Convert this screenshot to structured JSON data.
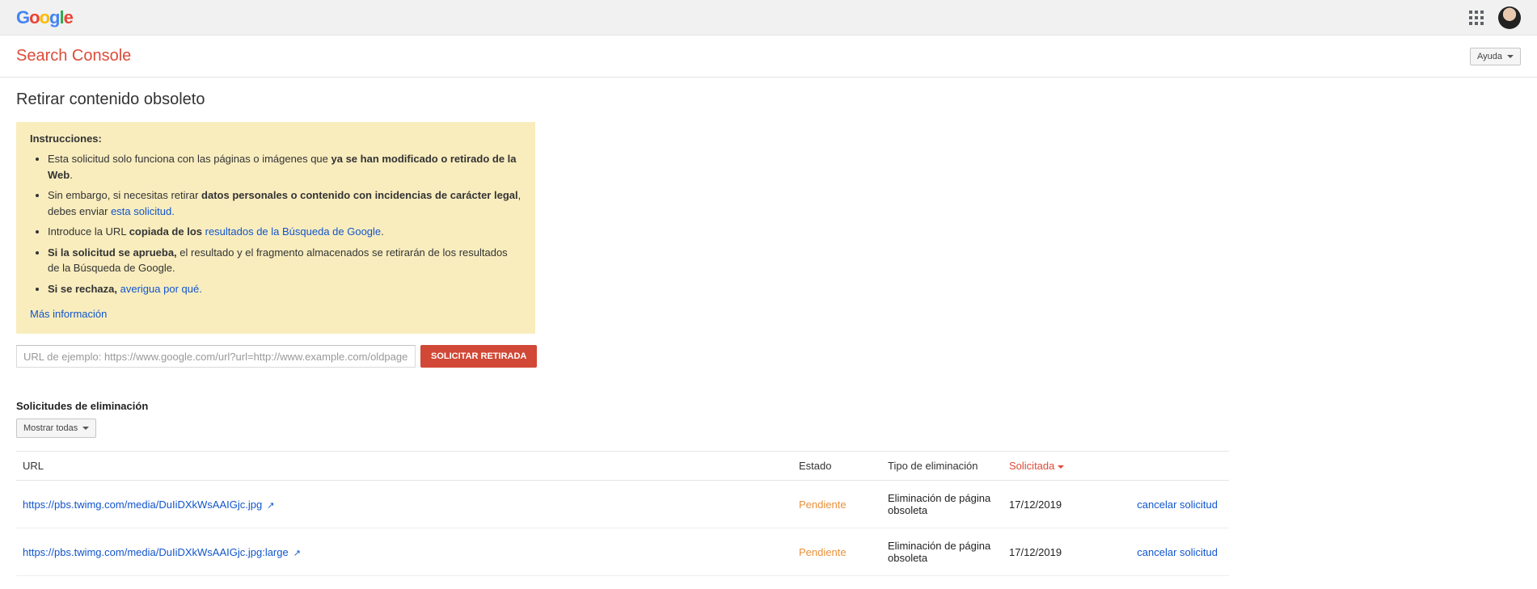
{
  "header": {
    "help_label": "Ayuda"
  },
  "app": {
    "title": "Search Console",
    "page_title": "Retirar contenido obsoleto"
  },
  "instructions": {
    "heading": "Instrucciones:",
    "li1_a": "Esta solicitud solo funciona con las páginas o imágenes que ",
    "li1_b": "ya se han modificado o retirado de la Web",
    "li1_c": ".",
    "li2_a": "Sin embargo, si necesitas retirar ",
    "li2_b": "datos personales o contenido con incidencias de carácter legal",
    "li2_c": ", debes enviar ",
    "li2_link": "esta solicitud.",
    "li3_a": "Introduce la URL ",
    "li3_b": "copiada de los ",
    "li3_link": "resultados de la Búsqueda de Google",
    "li3_c": ".",
    "li4_a": "Si la solicitud se aprueba,",
    "li4_b": " el resultado y el fragmento almacenados se retirarán de los resultados de la Búsqueda de Google.",
    "li5_a": "Si se rechaza,",
    "li5_b": " ",
    "li5_link": "averigua por qué.",
    "more_info": "Más información"
  },
  "form": {
    "url_placeholder": "URL de ejemplo: https://www.google.com/url?url=http://www.example.com/oldpage",
    "request_button": "SOLICITAR RETIRADA"
  },
  "requests": {
    "section_title": "Solicitudes de eliminación",
    "filter_label": "Mostrar todas",
    "columns": {
      "url": "URL",
      "estado": "Estado",
      "tipo": "Tipo de eliminación",
      "solicitada": "Solicitada"
    },
    "rows": [
      {
        "url": "https://pbs.twimg.com/media/DuIiDXkWsAAIGjc.jpg",
        "estado": "Pendiente",
        "tipo": "Eliminación de página obsoleta",
        "solicitada": "17/12/2019",
        "cancel": "cancelar solicitud"
      },
      {
        "url": "https://pbs.twimg.com/media/DuIiDXkWsAAIGjc.jpg:large",
        "estado": "Pendiente",
        "tipo": "Eliminación de página obsoleta",
        "solicitada": "17/12/2019",
        "cancel": "cancelar solicitud"
      }
    ]
  }
}
